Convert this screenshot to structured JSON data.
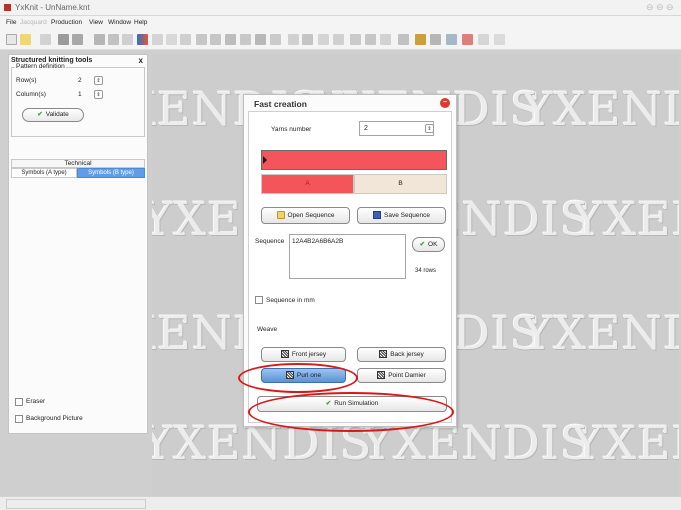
{
  "window": {
    "title": "YxKnit - UnName.knt"
  },
  "menu": {
    "items": [
      "File",
      "Jacquard",
      "Production",
      "View",
      "Window",
      "Help"
    ]
  },
  "left_panel": {
    "title": "Structured knitting tools",
    "close_glyph": "x",
    "pattern_definition": "Pattern definition",
    "rows_label": "Row(s)",
    "rows_value": "2",
    "columns_label": "Column(s)",
    "columns_value": "1",
    "validate_label": "Validate",
    "technical_label": "Technical",
    "tab1_label": "Symbols (A type)",
    "tab2_label": "Symbols (B type)",
    "eraser_label": "Eraser",
    "background_picture_label": "Background Picture"
  },
  "watermark": {
    "text": "YXENDIS"
  },
  "dialog": {
    "title": "Fast creation",
    "yarns_number_label": "Yarns number",
    "yarns_number_value": "2",
    "yarn_a_label": "A",
    "yarn_b_label": "B",
    "open_sequence_label": "Open Sequence",
    "save_sequence_label": "Save Sequence",
    "sequence_label": "Sequence",
    "sequence_value": "12A4B2A6B6A2B",
    "ok_label": "OK",
    "rows_count": "34 rows",
    "sequence_in_mm_label": "Sequence in mm",
    "weave_label": "Weave",
    "front_jersey_label": "Front jersey",
    "back_jersey_label": "Back jersey",
    "purl_one_label": "Purl one",
    "point_damier_label": "Point Damier",
    "run_simulation_label": "Run Simulation"
  },
  "colors": {
    "yarn_a": "#f4555a",
    "yarn_b": "#f1e6d8",
    "highlight": "#5b93d6",
    "annotation": "#d81919"
  }
}
